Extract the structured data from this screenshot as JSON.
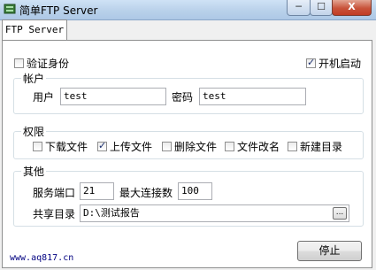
{
  "window": {
    "title": "简单FTP Server",
    "close_glyph": "X",
    "min_glyph": "─",
    "max_glyph": "☐"
  },
  "tab": {
    "label": "FTP Server"
  },
  "top": {
    "verify_identity": {
      "label": "验证身份",
      "checked": false
    },
    "auto_start": {
      "label": "开机启动",
      "checked": true
    }
  },
  "account": {
    "legend": "帐户",
    "user_label": "用户",
    "user_value": "test",
    "password_label": "密码",
    "password_value": "test"
  },
  "permissions": {
    "legend": "权限",
    "items": [
      {
        "label": "下载文件",
        "checked": false
      },
      {
        "label": "上传文件",
        "checked": true
      },
      {
        "label": "删除文件",
        "checked": false
      },
      {
        "label": "文件改名",
        "checked": false
      },
      {
        "label": "新建目录",
        "checked": false
      }
    ]
  },
  "other": {
    "legend": "其他",
    "port_label": "服务端口",
    "port_value": "21",
    "maxconn_label": "最大连接数",
    "maxconn_value": "100",
    "share_label": "共享目录",
    "share_value": "D:\\测试报告",
    "browse_label": "..."
  },
  "footer": {
    "stop_label": "停止",
    "url": "www.aq817.cn"
  }
}
